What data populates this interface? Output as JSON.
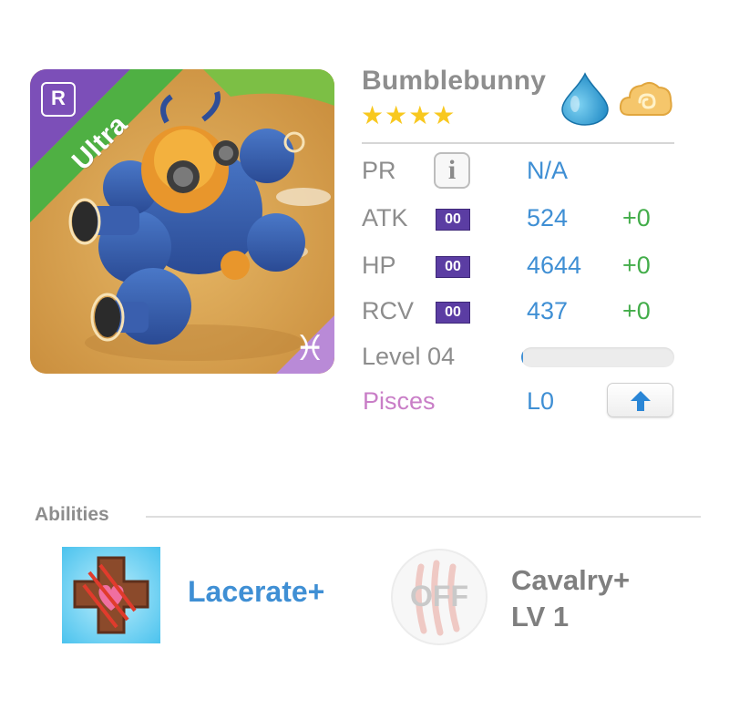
{
  "unit": {
    "name": "Bumblebunny",
    "stars": "★★★★",
    "rarity": "Ultra",
    "rank_letter": "R",
    "zodiac_glyph": "♓",
    "element_icon": "water-drop-icon",
    "type_icon": "cloud-swirl-icon"
  },
  "stats": {
    "pr": {
      "label": "PR",
      "value": "N/A"
    },
    "atk": {
      "label": "ATK",
      "plus": "00",
      "value": "524",
      "bonus": "+0"
    },
    "hp": {
      "label": "HP",
      "plus": "00",
      "value": "4644",
      "bonus": "+0"
    },
    "rcv": {
      "label": "RCV",
      "plus": "00",
      "value": "437",
      "bonus": "+0"
    }
  },
  "level": {
    "label": "Level 04",
    "xp_progress": 0.01
  },
  "zodiac": {
    "name": "Pisces",
    "level": "L0"
  },
  "abilities": {
    "title": "Abilities",
    "active": {
      "name": "Lacerate+"
    },
    "passive": {
      "status": "OFF",
      "name_line1": "Cavalry+",
      "name_line2": "LV 1"
    }
  },
  "colors": {
    "ultra_green": "#4fb043",
    "rank_purple": "#7c4fb8",
    "value_blue": "#3f8fd4",
    "bonus_green": "#43ad4a",
    "zodiac_pink": "#c97ec7",
    "plus_badge": "#5b3da3"
  }
}
